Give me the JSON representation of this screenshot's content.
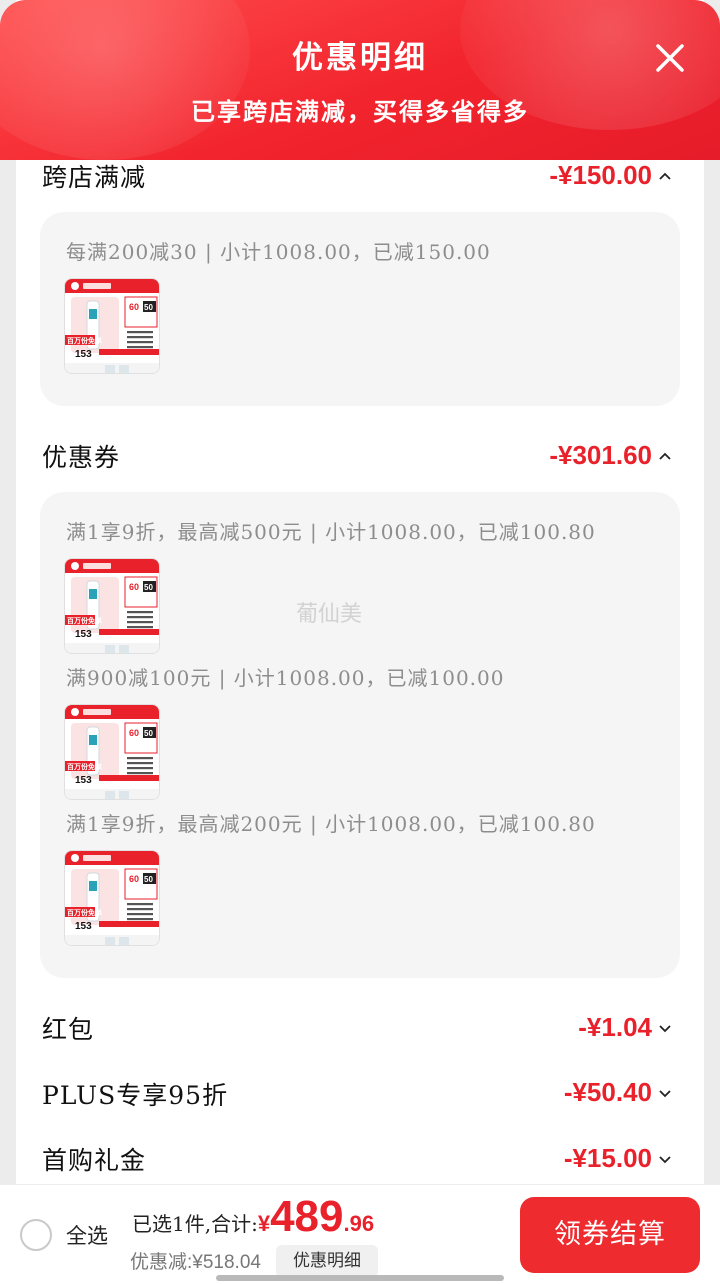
{
  "header": {
    "title": "优惠明细",
    "subtitle": "已享跨店满减，买得多省得多"
  },
  "sections": {
    "cross_store": {
      "title": "跨店满减",
      "amount": "-¥150.00",
      "rules": [
        "每满200减30 | 小计1008.00，已减150.00"
      ]
    },
    "coupon": {
      "title": "优惠券",
      "amount": "-¥301.60",
      "rules": [
        "满1享9折，最高减500元 | 小计1008.00，已减100.80",
        "满900减100元 | 小计1008.00，已减100.00",
        "满1享9折，最高减200元 | 小计1008.00，已减100.80"
      ]
    },
    "red_packet": {
      "title": "红包",
      "amount": "-¥1.04"
    },
    "plus": {
      "title": "PLUS专享95折",
      "amount": "-¥50.40"
    },
    "first_purchase": {
      "title": "首购礼金",
      "amount": "-¥15.00"
    }
  },
  "watermark": "葡仙美",
  "product_thumb": {
    "badge_top": "60",
    "badge_mid": "50",
    "price": "153",
    "promo": "百万份免单"
  },
  "footer": {
    "select_all": "全选",
    "selected_label": "已选1件,合计:",
    "currency": "¥",
    "total_int": "489",
    "total_dec": ".96",
    "discount": "优惠减:¥518.04",
    "detail_button": "优惠明细",
    "checkout_button": "领券结算"
  },
  "colors": {
    "accent_red": "#e8212b",
    "header_red": "#f2242d",
    "button_red": "#ee2b2f"
  }
}
